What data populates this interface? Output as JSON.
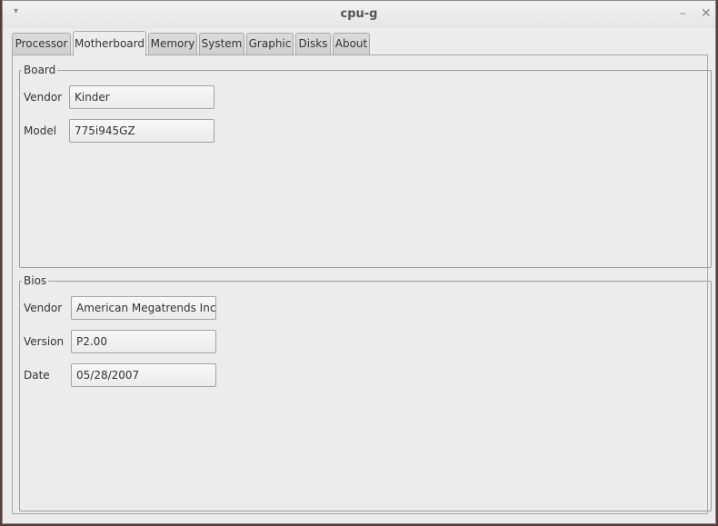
{
  "window": {
    "title": "cpu-g",
    "menu_icon": "▾",
    "minimize_icon": "–",
    "close_icon": "✕"
  },
  "tabs": [
    {
      "label": "Processor"
    },
    {
      "label": "Motherboard",
      "active": true
    },
    {
      "label": "Memory"
    },
    {
      "label": "System"
    },
    {
      "label": "Graphic"
    },
    {
      "label": "Disks"
    },
    {
      "label": "About"
    }
  ],
  "board": {
    "legend": "Board",
    "vendor_label": "Vendor",
    "vendor_value": "Kinder",
    "model_label": "Model",
    "model_value": "775i945GZ"
  },
  "bios": {
    "legend": "Bios",
    "vendor_label": "Vendor",
    "vendor_value": "American Megatrends Inc.",
    "version_label": "Version",
    "version_value": "P2.00",
    "date_label": "Date",
    "date_value": "05/28/2007"
  }
}
